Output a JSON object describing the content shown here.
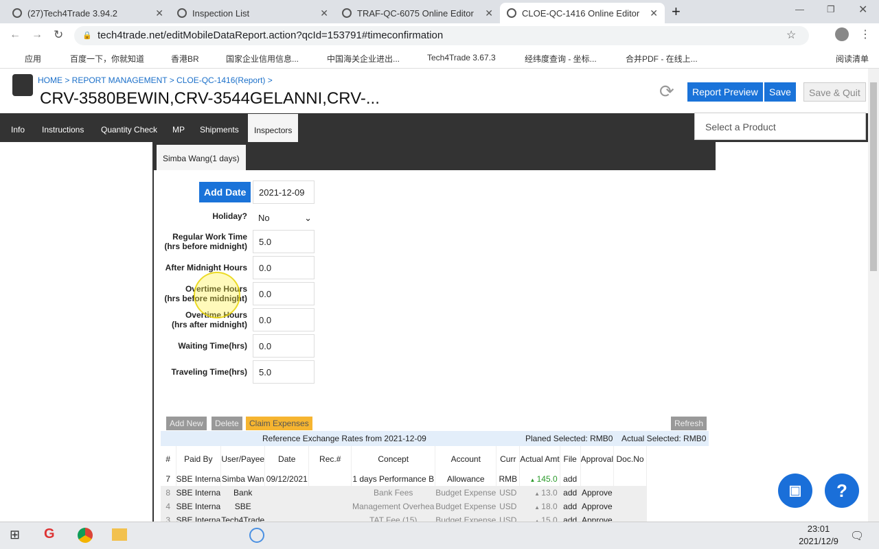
{
  "browser": {
    "tabs": [
      {
        "label": "(27)Tech4Trade 3.94.2"
      },
      {
        "label": "Inspection List"
      },
      {
        "label": "TRAF-QC-6075 Online Editor"
      },
      {
        "label": "CLOE-QC-1416 Online Editor"
      }
    ],
    "url": "tech4trade.net/editMobileDataReport.action?qcId=153791#timeconfirmation",
    "bookmarks": [
      "应用",
      "百度一下，你就知道",
      "香港BR",
      "国家企业信用信息...",
      "中国海关企业进出...",
      "Tech4Trade 3.67.3",
      "经纬度查询 - 坐标...",
      "合并PDF - 在线上..."
    ],
    "reading_list": "阅读清单"
  },
  "header": {
    "breadcrumb": "HOME > REPORT MANAGEMENT > CLOE-QC-1416(Report) >",
    "title": "CRV-3580BEWIN,CRV-3544GELANNI,CRV-...",
    "report_preview": "Report Preview",
    "save": "Save",
    "save_quit": "Save & Quit"
  },
  "nav": {
    "items": [
      "Info",
      "Instructions",
      "Quantity Check",
      "MP",
      "Shipments",
      "Inspectors"
    ],
    "select_placeholder": "Select a Product"
  },
  "inspector": {
    "tab": "Simba Wang(1 days)",
    "add_date": "Add Date",
    "date": "2021-12-09",
    "fields": [
      {
        "label": "Holiday?",
        "value": "No"
      },
      {
        "label": "Regular Work Time\n(hrs before midnight)",
        "value": "5.0"
      },
      {
        "label": "After Midnight Hours",
        "value": "0.0"
      },
      {
        "label": "Overtime Hours\n(hrs before midnight)",
        "value": "0.0"
      },
      {
        "label": "Overtime Hours\n(hrs after midnight)",
        "value": "0.0"
      },
      {
        "label": "Waiting Time(hrs)",
        "value": "0.0"
      },
      {
        "label": "Traveling Time(hrs)",
        "value": "5.0"
      }
    ]
  },
  "expenses": {
    "add_new": "Add New",
    "delete": "Delete",
    "claim": "Claim Expenses",
    "refresh": "Refresh",
    "rates": "Reference Exchange Rates from 2021-12-09",
    "planed": "Planed Selected: RMB0",
    "actual": "Actual Selected: RMB0",
    "columns": [
      "#",
      "Paid By",
      "User/Payee",
      "Date",
      "Rec.#",
      "Concept",
      "Account",
      "Curr",
      "Actual Amt",
      "File",
      "Approval",
      "Doc.No"
    ],
    "rows": [
      [
        "7",
        "SBE Interna",
        "Simba Wan",
        "09/12/2021",
        "",
        "1 days Performance B",
        "Allowance",
        "RMB",
        "145.0",
        "add",
        "",
        ""
      ],
      [
        "8",
        "SBE Interna",
        "Bank",
        "",
        "",
        "Bank Fees",
        "Budget Expense",
        "USD",
        "13.0",
        "add",
        "Approve",
        ""
      ],
      [
        "4",
        "SBE Interna",
        "SBE",
        "",
        "",
        "Management Overhea",
        "Budget Expense",
        "USD",
        "18.0",
        "add",
        "Approve",
        ""
      ],
      [
        "3",
        "SBE Interna",
        "Tech4Trade",
        "",
        "",
        "TAT Fee (15)",
        "Budget Expense",
        "USD",
        "15.0",
        "add",
        "Approve",
        ""
      ]
    ]
  },
  "taskbar": {
    "time": "23:01",
    "date": "2021/12/9"
  }
}
